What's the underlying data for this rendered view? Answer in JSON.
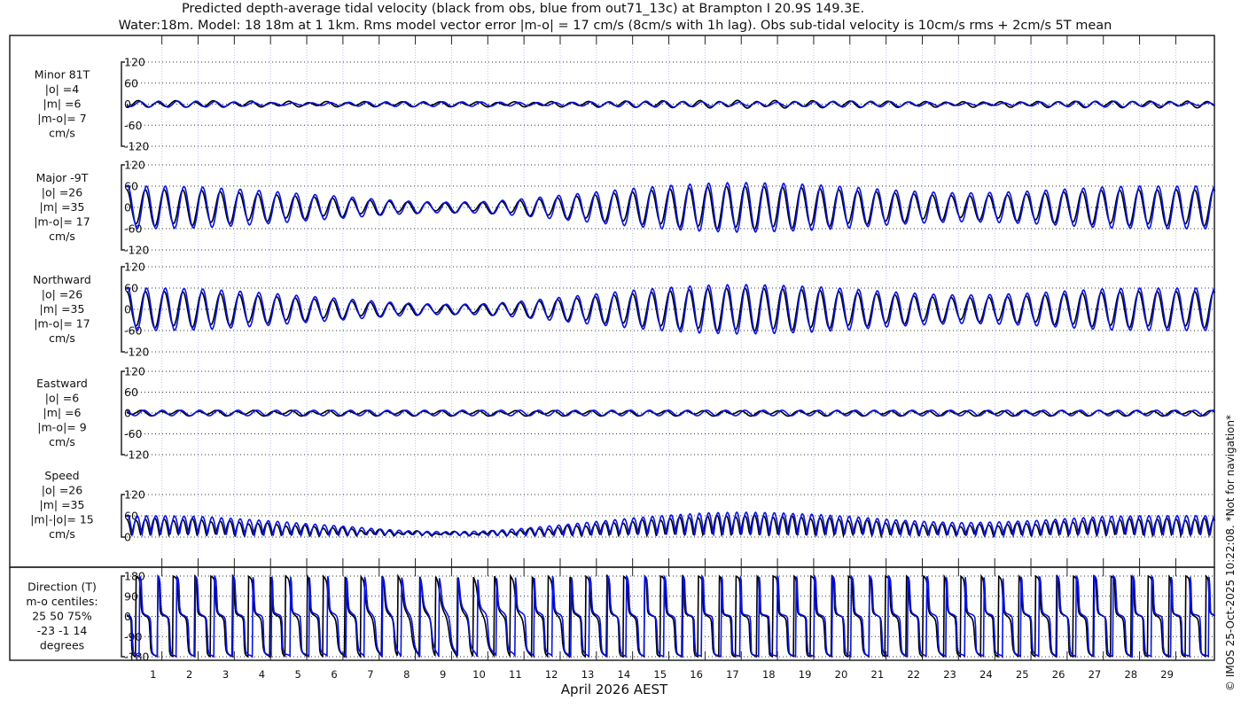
{
  "chart_data": {
    "type": "line",
    "title": "Predicted depth-average tidal velocity (black from obs, blue from out71_13c) at Brampton I 20.9S 149.3E.",
    "subtitle": "Water:18m. Model: 18 18m at 1 1km. Rms model vector error |m-o| = 17 cm/s (8cm/s with 1h lag). Obs sub-tidal velocity is 10cm/s rms + 2cm/s 5T mean",
    "xlabel": "April 2026 AEST",
    "x_ticks": [
      "1",
      "2",
      "3",
      "4",
      "5",
      "6",
      "7",
      "8",
      "9",
      "10",
      "11",
      "12",
      "13",
      "14",
      "15",
      "16",
      "17",
      "18",
      "19",
      "20",
      "21",
      "22",
      "23",
      "24",
      "25",
      "26",
      "27",
      "28",
      "29"
    ],
    "side_note": "© IMOS 25-Oct-2025 10:22:08. *Not for navigation*",
    "series_colors": {
      "obs": "#000000",
      "model": "#0a14e6"
    },
    "tidal_period_days": 0.5175,
    "envelope_days": [
      0,
      1,
      2,
      3,
      4,
      5,
      6,
      7,
      8,
      9,
      10,
      11,
      12,
      13,
      14,
      15,
      16,
      17,
      18,
      19,
      20,
      21,
      22,
      23,
      24,
      25,
      26,
      27,
      28,
      29,
      30
    ],
    "north_amp_obs": [
      50,
      50,
      48,
      42,
      36,
      30,
      24,
      18,
      14,
      12,
      14,
      20,
      28,
      36,
      44,
      52,
      58,
      60,
      58,
      54,
      48,
      42,
      36,
      32,
      34,
      38,
      44,
      48,
      50,
      50,
      50
    ],
    "north_amp_model": [
      60,
      60,
      58,
      52,
      45,
      37,
      30,
      22,
      16,
      14,
      16,
      24,
      34,
      44,
      54,
      62,
      68,
      70,
      68,
      64,
      58,
      50,
      44,
      40,
      42,
      46,
      52,
      58,
      60,
      60,
      60
    ],
    "east_amp_obs": 6,
    "east_amp_model": 8,
    "panels": [
      {
        "key": "minor",
        "labels": [
          "Minor 81T",
          "|o| =4",
          "|m| =6",
          "|m-o|= 7",
          "cm/s"
        ],
        "ylim": [
          -120,
          120
        ],
        "ticks": [
          "120",
          "60",
          "0",
          "-60",
          "-120"
        ]
      },
      {
        "key": "major",
        "labels": [
          "Major -9T",
          "|o| =26",
          "|m| =35",
          "|m-o|= 17",
          "cm/s"
        ],
        "ylim": [
          -120,
          120
        ],
        "ticks": [
          "120",
          "60",
          "0",
          "-60",
          "-120"
        ]
      },
      {
        "key": "north",
        "labels": [
          "Northward",
          "|o| =26",
          "|m| =35",
          "|m-o|= 17",
          "cm/s"
        ],
        "ylim": [
          -120,
          120
        ],
        "ticks": [
          "120",
          "60",
          "0",
          "-60",
          "-120"
        ]
      },
      {
        "key": "east",
        "labels": [
          "Eastward",
          "|o| =6",
          "|m| =6",
          "|m-o|= 9",
          "cm/s"
        ],
        "ylim": [
          -120,
          120
        ],
        "ticks": [
          "120",
          "60",
          "0",
          "-60",
          "-120"
        ]
      },
      {
        "key": "speed",
        "labels": [
          "Speed",
          "|o| =26",
          "|m| =35",
          "|m|-|o|= 15",
          "cm/s"
        ],
        "ylim": [
          0,
          120
        ],
        "ticks": [
          "120",
          "60",
          "0"
        ]
      },
      {
        "key": "dir",
        "labels": [
          "Direction (T)",
          "m-o centiles:",
          "25  50  75%",
          "-23  -1  14",
          "degrees"
        ],
        "ylim": [
          -180,
          180
        ],
        "ticks": [
          "180",
          "90",
          "0",
          "-90",
          "-180"
        ]
      }
    ]
  }
}
